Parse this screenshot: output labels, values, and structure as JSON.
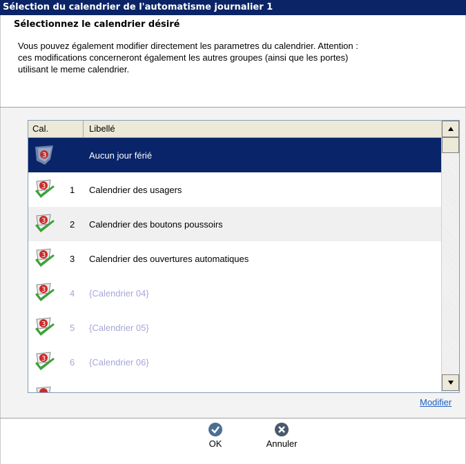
{
  "window": {
    "title": "Sélection du calendrier de l'automatisme journalier 1"
  },
  "header": {
    "heading": "Sélectionnez le calendrier désiré",
    "description": "Vous pouvez également modifier directement les parametres du calendrier. Attention :\nces modifications concerneront également les autres groupes (ainsi que les portes)\nutilisant le meme calendrier."
  },
  "list": {
    "columns": {
      "cal": "Cal.",
      "libelle": "Libellé"
    },
    "rows": [
      {
        "num": "",
        "label": "Aucun jour férié",
        "state": "selected",
        "icon": "calendar-none-icon"
      },
      {
        "num": "1",
        "label": "Calendrier des usagers",
        "state": "normal",
        "icon": "calendar-check-icon"
      },
      {
        "num": "2",
        "label": "Calendrier des boutons poussoirs",
        "state": "normal",
        "icon": "calendar-check-icon"
      },
      {
        "num": "3",
        "label": "Calendrier des ouvertures automatiques",
        "state": "normal",
        "icon": "calendar-check-icon"
      },
      {
        "num": "4",
        "label": "{Calendrier 04}",
        "state": "disabled",
        "icon": "calendar-check-icon"
      },
      {
        "num": "5",
        "label": "{Calendrier 05}",
        "state": "disabled",
        "icon": "calendar-check-icon"
      },
      {
        "num": "6",
        "label": "{Calendrier 06}",
        "state": "disabled",
        "icon": "calendar-check-icon"
      },
      {
        "num": "",
        "label": "",
        "state": "normal",
        "icon": "calendar-check-icon"
      }
    ]
  },
  "links": {
    "modifier": "Modifier"
  },
  "buttons": {
    "ok": "OK",
    "cancel": "Annuler"
  },
  "colors": {
    "title_bg": "#0b2466",
    "selection_bg": "#0a246a",
    "disabled_text": "#a6a6d6",
    "link": "#1f5fbf"
  }
}
